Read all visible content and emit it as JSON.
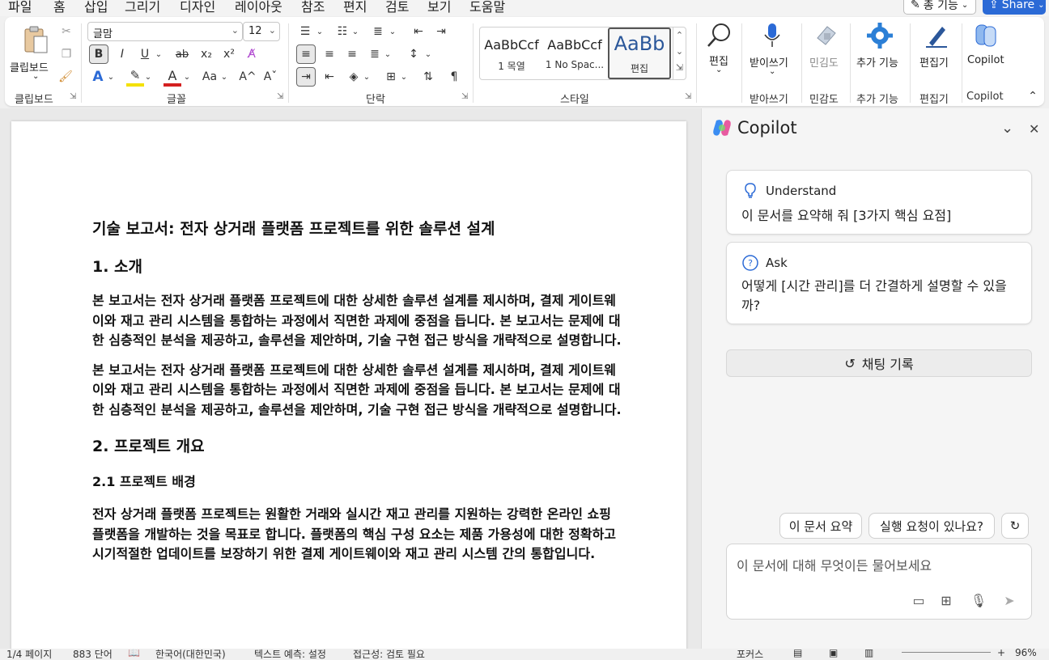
{
  "tabs": [
    "파일",
    "홈",
    "삽입",
    "그리기",
    "디자인",
    "레이아웃",
    "참조",
    "편지",
    "검토",
    "보기",
    "도움말"
  ],
  "active_tab": "홈",
  "top_buttons": {
    "edit_mode": "총 기능",
    "share": "Share"
  },
  "ribbon": {
    "clipboard": {
      "paste_label": "클립보드",
      "group_label": "클립보드"
    },
    "font": {
      "font_name": "글맘",
      "font_size": "12",
      "group_label": "글꼴",
      "buttons": [
        "B",
        "I",
        "U",
        "ab",
        "x₂",
        "x²",
        "Aᵃ",
        "Aa",
        "A^",
        "Aˇ"
      ]
    },
    "paragraph": {
      "group_label": "단락"
    },
    "styles": {
      "group_label": "스타일",
      "items": [
        {
          "sample": "AaBbCcf",
          "name": "1 목열"
        },
        {
          "sample": "AaBbCcf",
          "name": "1 No Spac..."
        },
        {
          "sample": "AaBb",
          "name": "편집"
        }
      ]
    },
    "editing": {
      "label": "편집",
      "group_label": ""
    },
    "dictate": {
      "label": "받이쓰기",
      "group_label": "받아쓰기"
    },
    "sensitivity": {
      "label": "민김도",
      "group_label": "민감도"
    },
    "addins": {
      "label": "추가 기능",
      "group_label": "추가 기능"
    },
    "editor": {
      "label": "편집기",
      "group_label": "편집기"
    },
    "copilot": {
      "label": "Copilot",
      "group_label": "Copilot"
    }
  },
  "document": {
    "title": "기술 보고서: 전자 상거래 플랫폼 프로젝트를 위한 솔루션 설계",
    "h_intro": "1. 소개",
    "p1": "본 보고서는 전자 상거래 플랫폼 프로젝트에 대한 상세한 솔루션 설계를 제시하며, 결제 게이트웨이와 재고 관리 시스템을 통합하는 과정에서 직면한 과제에 중점을 듭니다. 본 보고서는 문제에 대한 심층적인 분석을 제공하고, 솔루션을 제안하며, 기술 구현 접근 방식을 개략적으로 설명합니다.",
    "p2": "본 보고서는 전자 상거래 플랫폼 프로젝트에 대한 상세한 솔루션 설계를 제시하며, 결제 게이트웨이와 재고 관리 시스템을 통합하는 과정에서 직면한 과제에 중점을 듭니다. 본 보고서는 문제에 대한 심층적인 분석을 제공하고, 솔루션을 제안하며, 기술 구현 접근 방식을 개략적으로 설명합니다.",
    "h_overview": "2. 프로젝트 개요",
    "h_background": "2.1 프로젝트 배경",
    "p3": "전자 상거래 플랫폼 프로젝트는 원활한 거래와 실시간 재고 관리를 지원하는 강력한 온라인 쇼핑 플랫폼을 개발하는 것을 목표로 합니다. 플랫폼의 핵심 구성 요소는 제품 가용성에 대한 정확하고 시기적절한 업데이트를 보장하기 위한 결제 게이트웨이와 재고 관리 시스템 간의 통합입니다."
  },
  "copilot": {
    "title": "Copilot",
    "card1": {
      "title": "Understand",
      "text": "이 문서를 요약해 줘 [3가지 핵심 요점]"
    },
    "card2": {
      "title": "Ask",
      "text": "어떻게 [시간 관리]를 더 간결하게 설명할 수 있을까?"
    },
    "history": "채팅 기록",
    "chips": [
      "이 문서 요약",
      "실행 요청이 있나요?"
    ],
    "input_placeholder": "이 문서에 대해 무엇이든 물어보세요"
  },
  "status": {
    "page": "1/4 페이지",
    "words": "883 단어",
    "language": "한국어(대한민국)",
    "predict": "텍스트 예측: 설정",
    "access": "접근성: 검토 필요",
    "focus": "포커스",
    "zoom": "96%"
  },
  "colors": {
    "accent": "#2b579a",
    "share": "#2b6ad6"
  }
}
